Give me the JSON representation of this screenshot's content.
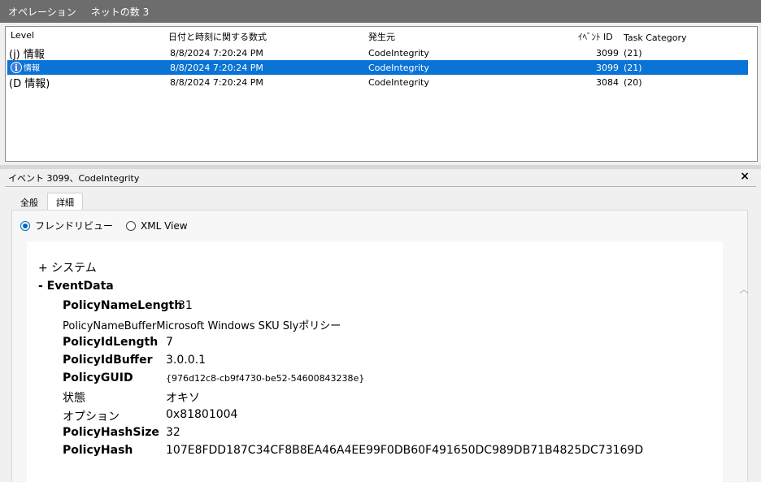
{
  "titlebar": {
    "label1": "オペレーション",
    "label2": "ネットの数 3"
  },
  "columns": {
    "level": "Level",
    "date": "日付と時刻に関する数式",
    "source": "発生元",
    "event_id": "ｲﾍﾞﾝﾄ ID",
    "task": "Task Category"
  },
  "rows": [
    {
      "level": "(j) 情報",
      "date": "8/8/2024 7:20:24 PM",
      "source": "CodeIntegrity",
      "event_id": "3099",
      "task": "(21)"
    },
    {
      "level": "情報",
      "date": "8/8/2024 7:20:24 PM",
      "source": "CodeIntegrity",
      "event_id": "3099",
      "task": "(21)"
    },
    {
      "level": "(D 情報)",
      "date": "8/8/2024 7:20:24 PM",
      "source": "CodeIntegrity",
      "event_id": "3084",
      "task": "(20)"
    }
  ],
  "detail": {
    "title": "イベント 3099、CodeIntegrity",
    "close": "×",
    "tabs": [
      "全般",
      "詳細"
    ],
    "radio_friendly": "フレンドリビュー",
    "radio_xml": "XML View",
    "system": "+ システム",
    "eventdata": "- EventData",
    "fields": [
      {
        "key": "PolicyNameLength",
        "value": "31"
      },
      {
        "key": "PolicyNameBufferMicrosoft Windows SKU Slyポリシー",
        "value": ""
      },
      {
        "key": "PolicyIdLength",
        "value": "7"
      },
      {
        "key": "PolicyIdBuffer",
        "value": "3.0.0.1"
      },
      {
        "key": "PolicyGUID",
        "value": "{976d12c8-cb9f4730-be52-54600843238e}"
      },
      {
        "key": "状態",
        "value": "オキソ"
      },
      {
        "key": "オプション",
        "value": "0x81801004"
      },
      {
        "key": "PolicyHashSize",
        "value": "32"
      },
      {
        "key": "PolicyHash",
        "value": "107E8FDD187C34CF8B8EA46A4EE99F0DB60F491650DC989DB71B4825DC73169D"
      }
    ]
  },
  "colors": {
    "selection": "#0a73d6",
    "titlebar": "#6d6d6d"
  }
}
